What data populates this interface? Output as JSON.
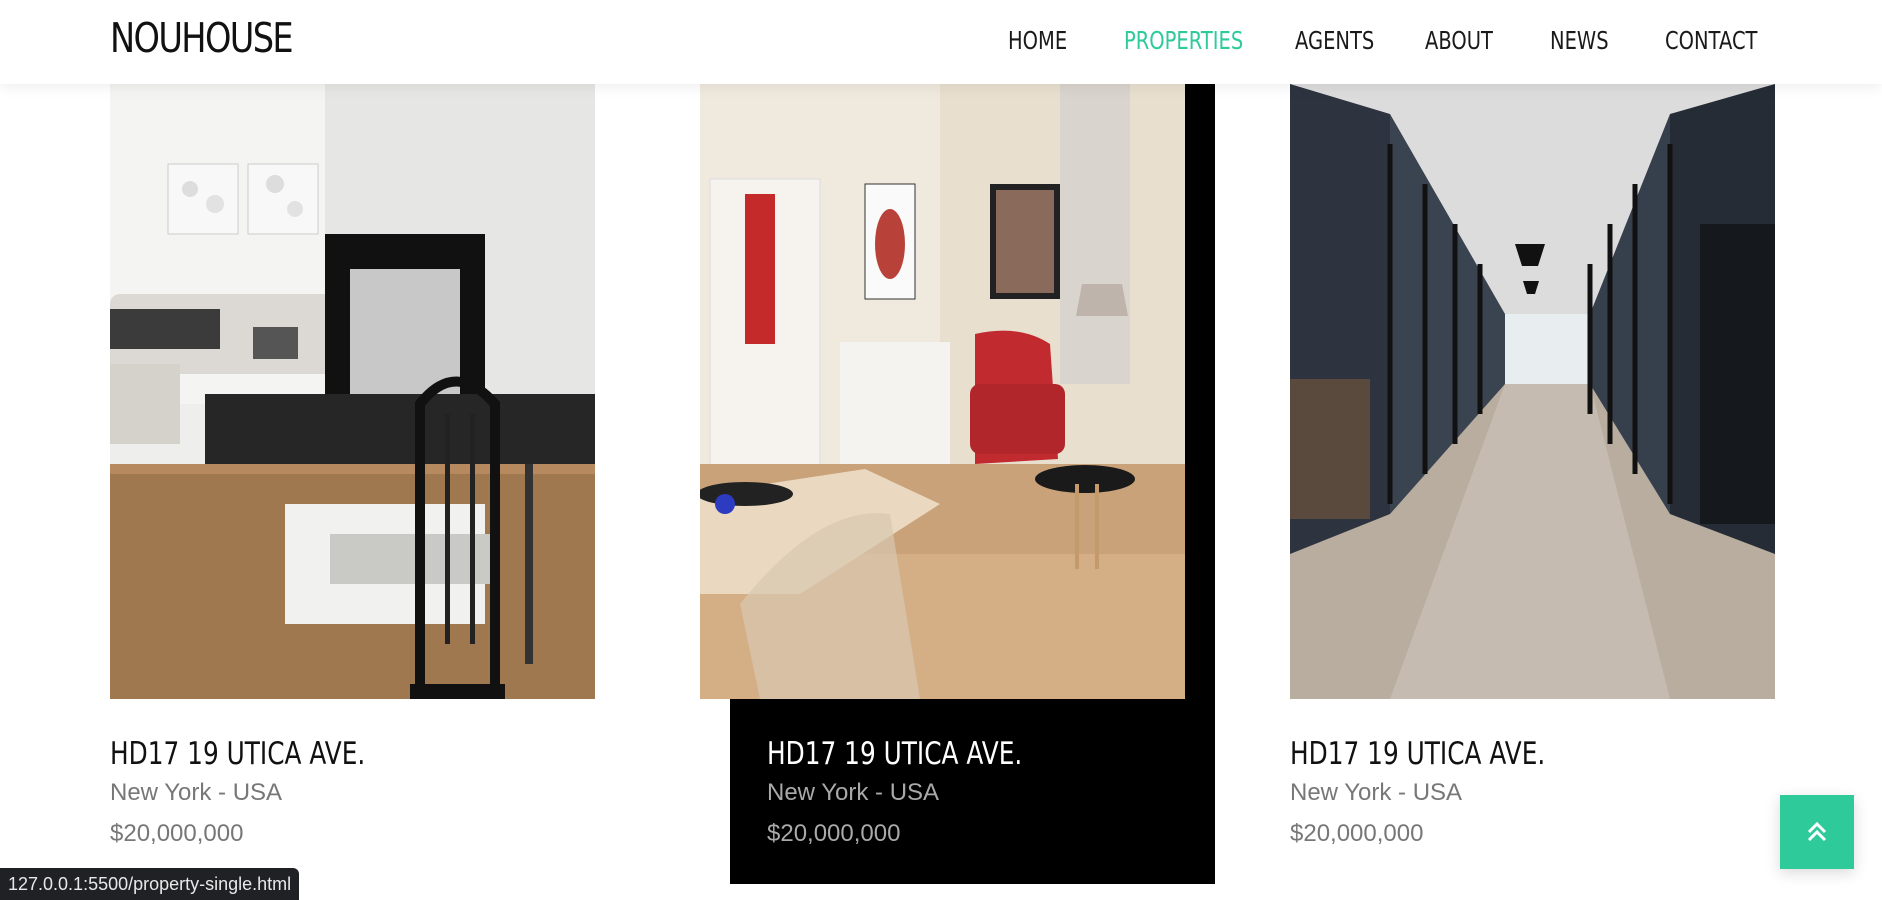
{
  "brand": "NOUHOUSE",
  "nav": {
    "items": [
      {
        "label": "HOME",
        "active": false
      },
      {
        "label": "PROPERTIES",
        "active": true
      },
      {
        "label": "AGENTS",
        "active": false
      },
      {
        "label": "ABOUT",
        "active": false
      },
      {
        "label": "NEWS",
        "active": false
      },
      {
        "label": "CONTACT",
        "active": false
      }
    ]
  },
  "properties": [
    {
      "title": "HD17 19 UTICA AVE.",
      "location": "New York - USA",
      "price": "$20,000,000",
      "photo": "living-room-fireplace"
    },
    {
      "title": "HD17 19 UTICA AVE.",
      "location": "New York - USA",
      "price": "$20,000,000",
      "photo": "living-room-red-chair"
    },
    {
      "title": "HD17 19 UTICA AVE.",
      "location": "New York - USA",
      "price": "$20,000,000",
      "photo": "office-corridor"
    }
  ],
  "back_to_top_icon": "double-chevron-up-icon",
  "status_bar": {
    "url": "127.0.0.1:5500/property-single.html"
  },
  "colors": {
    "accent": "#2eca9a",
    "text": "#111111",
    "muted": "#777777",
    "dark_card": "#000000"
  }
}
